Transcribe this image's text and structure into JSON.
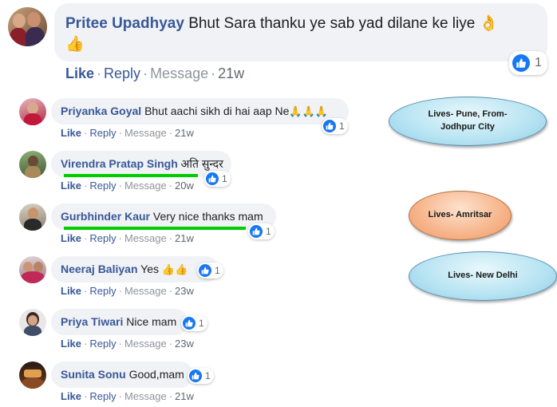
{
  "top_comment": {
    "name": "Pritee Upadhyay",
    "text": "Bhut Sara thanku ye sab yad dilane ke liye",
    "emoji_1": "👌",
    "emoji_2": "👍",
    "like": "Like",
    "reply": "Reply",
    "message": "Message",
    "time": "21w",
    "reaction_count": "1"
  },
  "replies": [
    {
      "name": "Priyanka Goyal",
      "text": "Bhut aachi sikh di hai aap Ne",
      "emoji": "🙏🙏🙏",
      "like": "Like",
      "reply": "Reply",
      "message": "Message",
      "time": "21w",
      "reaction_count": "1"
    },
    {
      "name": "Virendra Pratap Singh",
      "text": "अति सुन्दर",
      "emoji": "",
      "like": "Like",
      "reply": "Reply",
      "message": "Message",
      "time": "20w",
      "reaction_count": "1"
    },
    {
      "name": "Gurbhinder Kaur",
      "text": "Very nice thanks mam",
      "emoji": "",
      "like": "Like",
      "reply": "Reply",
      "message": "Message",
      "time": "21w",
      "reaction_count": "1"
    },
    {
      "name": "Neeraj Baliyan",
      "text": "Yes",
      "emoji": "👍👍",
      "like": "Like",
      "reply": "Reply",
      "message": "Message",
      "time": "23w",
      "reaction_count": "1"
    },
    {
      "name": "Priya Tiwari",
      "text": "Nice mam",
      "emoji": "",
      "like": "Like",
      "reply": "Reply",
      "message": "Message",
      "time": "23w",
      "reaction_count": "1"
    },
    {
      "name": "Sunita Sonu",
      "text": "Good,mam",
      "emoji": "",
      "like": "Like",
      "reply": "Reply",
      "message": "Message",
      "time": "21w",
      "reaction_count": "1"
    }
  ],
  "callouts": {
    "pune_line1": "Lives- Pune, From-",
    "pune_line2": "Jodhpur City",
    "amritsar": "Lives- Amritsar",
    "delhi": "Lives- New Delhi"
  },
  "colors": {
    "name_blue": "#385898",
    "bubble_gray": "#f0f2f5",
    "like_blue": "#1877f2",
    "highlight_green": "#00cc00"
  }
}
